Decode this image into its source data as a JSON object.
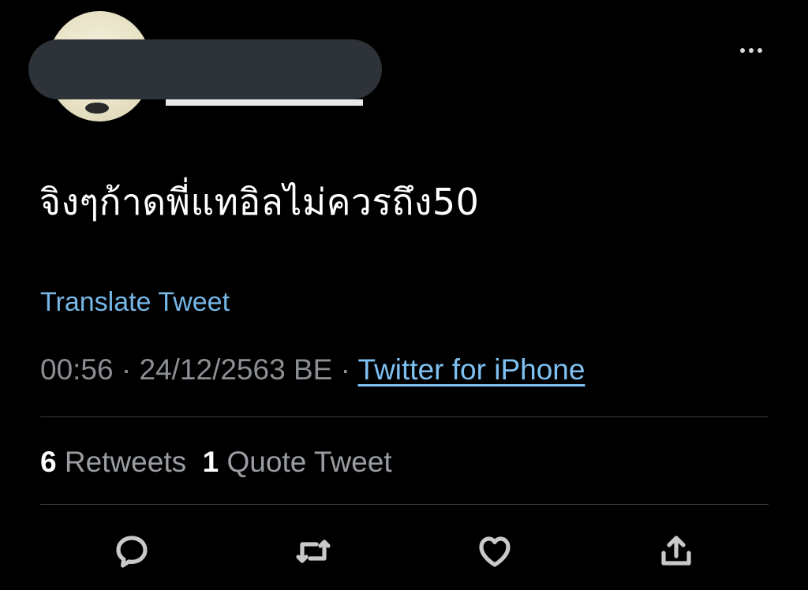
{
  "tweet": {
    "text": "จิงๆก้าดพี่แทอิลไม่ควรถึง50",
    "translate_label": "Translate Tweet",
    "time": "00:56",
    "date": "24/12/2563 BE",
    "source": "Twitter for iPhone",
    "separator": " · "
  },
  "stats": {
    "retweets_count": "6",
    "retweets_label": "Retweets",
    "quotes_count": "1",
    "quotes_label": "Quote Tweet"
  },
  "icons": {
    "more": "more-dots-icon",
    "reply": "reply-icon",
    "retweet": "retweet-icon",
    "like": "heart-icon",
    "share": "share-icon"
  },
  "colors": {
    "background": "#000000",
    "link": "#76b7e6",
    "muted": "#8b8f94",
    "divider": "#3a3a3c"
  }
}
